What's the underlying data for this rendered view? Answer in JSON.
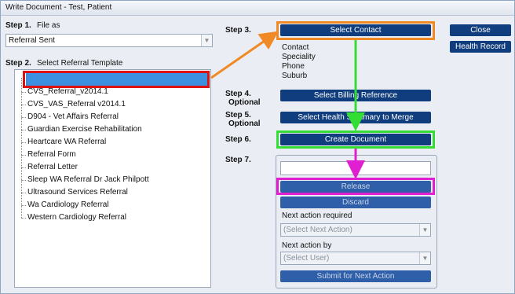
{
  "window": {
    "title": "Write Document - Test, Patient"
  },
  "step1": {
    "label": "Step 1.",
    "text": "File as",
    "value": "Referral Sent"
  },
  "step2": {
    "label": "Step 2.",
    "text": "Select Referral Template",
    "items": [
      "CVS_Referral_v2014.1",
      "CVS_VAS_Referral v2014.1",
      "D904 - Vet Affairs Referral",
      "Guardian Exercise Rehabilitation",
      "Heartcare WA Referral",
      "Referral Form",
      "Referral Letter",
      "Sleep WA  Referral    Dr Jack Philpott",
      "Ultrasound Services  Referral",
      "Wa Cardiology  Referral",
      "Western Cardiology  Referral"
    ]
  },
  "step3": {
    "label": "Step 3.",
    "button": "Select Contact",
    "fields": [
      "Contact",
      "Speciality",
      "Phone",
      "Suburb"
    ]
  },
  "step4": {
    "label": "Step 4.",
    "sub": "Optional",
    "button": "Select Billing Reference"
  },
  "step5": {
    "label": "Step 5.",
    "sub": "Optional",
    "button": "Select Health Summary to Merge"
  },
  "step6": {
    "label": "Step 6.",
    "button": "Create Document"
  },
  "step7": {
    "label": "Step 7.",
    "release": "Release",
    "discard": "Discard",
    "next_action_label": "Next action required",
    "next_action_value": "(Select Next Action)",
    "next_by_label": "Next action by",
    "next_by_value": "(Select User)",
    "submit": "Submit for Next Action"
  },
  "actions": {
    "close": "Close",
    "health_record": "Health Record"
  },
  "colors": {
    "orange": "#f08a24",
    "green": "#33dd33",
    "magenta": "#e020d0",
    "red": "#dd1111",
    "button": "#0f3d7e"
  }
}
